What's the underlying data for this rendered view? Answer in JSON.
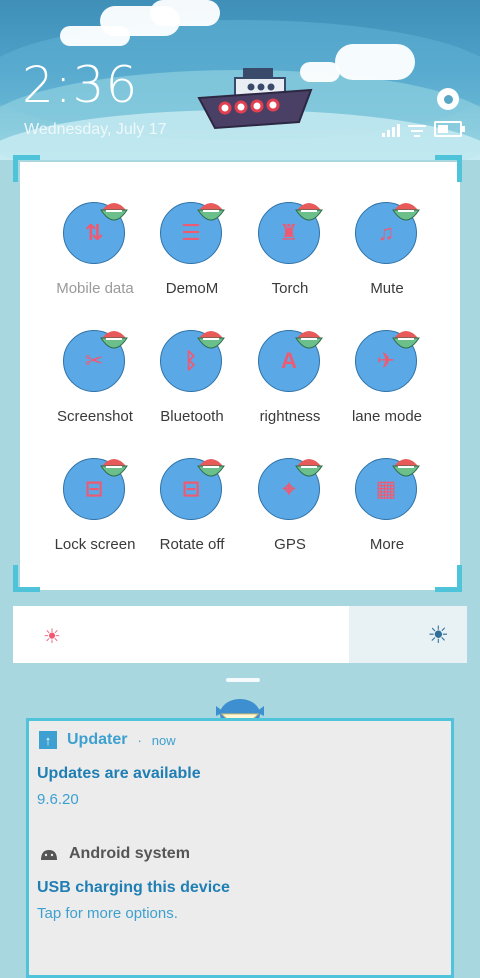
{
  "status": {
    "time": "2:36",
    "date": "Wednesday, July 17",
    "battery_level": 0.6
  },
  "quick_settings": {
    "tiles": [
      {
        "name": "mobile-data",
        "label": "Mobile data",
        "icon": "mobile-data-icon",
        "glyph": "⇅",
        "dim": true
      },
      {
        "name": "demo-mode",
        "label": "DemoM",
        "icon": "filter-icon",
        "glyph": "☰",
        "dim": false
      },
      {
        "name": "torch",
        "label": "Torch",
        "icon": "flashlight-icon",
        "glyph": "♜",
        "dim": false
      },
      {
        "name": "mute",
        "label": "Mute",
        "icon": "bell-icon",
        "glyph": "♫",
        "dim": false
      },
      {
        "name": "screenshot",
        "label": "Screenshot",
        "icon": "scissors-icon",
        "glyph": "✂",
        "dim": false
      },
      {
        "name": "bluetooth",
        "label": "Bluetooth",
        "icon": "bluetooth-icon",
        "glyph": "ᛒ",
        "dim": false
      },
      {
        "name": "brightness",
        "label": "rightness",
        "icon": "brightness-auto-icon",
        "glyph": "A",
        "dim": false
      },
      {
        "name": "airplane-mode",
        "label": "lane mode",
        "icon": "airplane-icon",
        "glyph": "✈",
        "dim": false
      },
      {
        "name": "lock-screen",
        "label": "Lock screen",
        "icon": "lock-icon",
        "glyph": "⊟",
        "dim": false
      },
      {
        "name": "rotate-off",
        "label": "Rotate off",
        "icon": "rotate-lock-icon",
        "glyph": "⊟",
        "dim": false
      },
      {
        "name": "gps",
        "label": "GPS",
        "icon": "gps-crosshair-icon",
        "glyph": "⌖",
        "dim": false
      },
      {
        "name": "more",
        "label": "More",
        "icon": "grid-icon",
        "glyph": "▦",
        "dim": false
      }
    ]
  },
  "brightness": {
    "level": 0.74
  },
  "notifications": [
    {
      "app": "Updater",
      "time": "now",
      "title": "Updates are available",
      "body": "9.6.20"
    },
    {
      "app": "Android system",
      "title": "USB charging this device",
      "body": "Tap for more options."
    }
  ],
  "colors": {
    "accent": "#4fc3da",
    "tile": "#5aa9e6",
    "glyph": "#ef5a73"
  }
}
